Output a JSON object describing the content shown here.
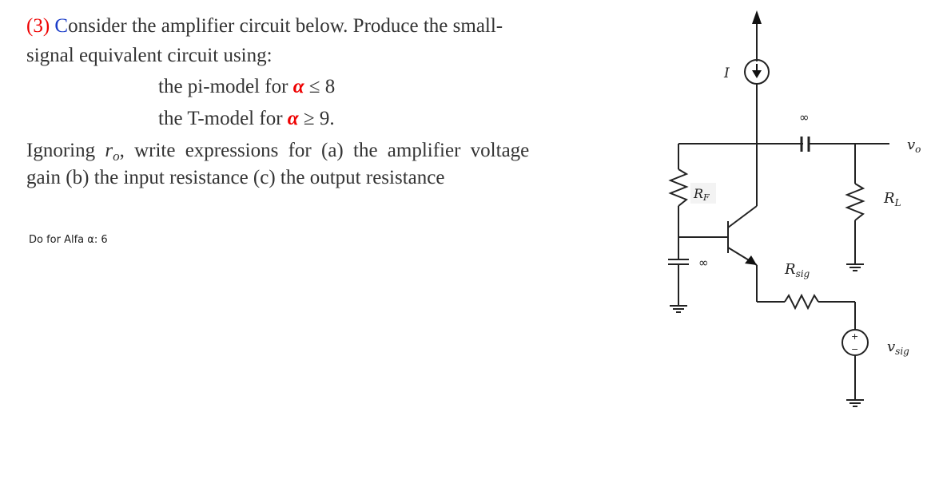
{
  "question": {
    "number": "(3)",
    "line1_first_letter": "C",
    "line1_rest": "onsider the amplifier circuit below. Produce the small-",
    "line2": "signal equivalent circuit using:",
    "line3_text": "the pi-model for ",
    "line3_symbol": "α",
    "line3_condition": " ≤ 8",
    "line4_text": "the T-model for ",
    "line4_symbol": "α",
    "line4_condition": " ≥ 9.",
    "line5_pre": "Ignoring ",
    "line5_var": "r",
    "line5_sub": "o",
    "line5_post": ", write expressions for (a) the amplifier voltage",
    "line6": "gain (b) the input resistance (c) the output resistance"
  },
  "note": "Do for Alfa α: 6",
  "circuit": {
    "current_source_label": "I",
    "cap_top_label": "∞",
    "cap_bottom_label": "∞",
    "output_label": "v",
    "output_sub": "o",
    "rf_label": "R",
    "rf_sub": "F",
    "rl_label": "R",
    "rl_sub": "L",
    "rsig_label": "R",
    "rsig_sub": "sig",
    "vsig_label": "v",
    "vsig_sub": "sig",
    "plus_sign": "+",
    "minus_sign": "−"
  }
}
